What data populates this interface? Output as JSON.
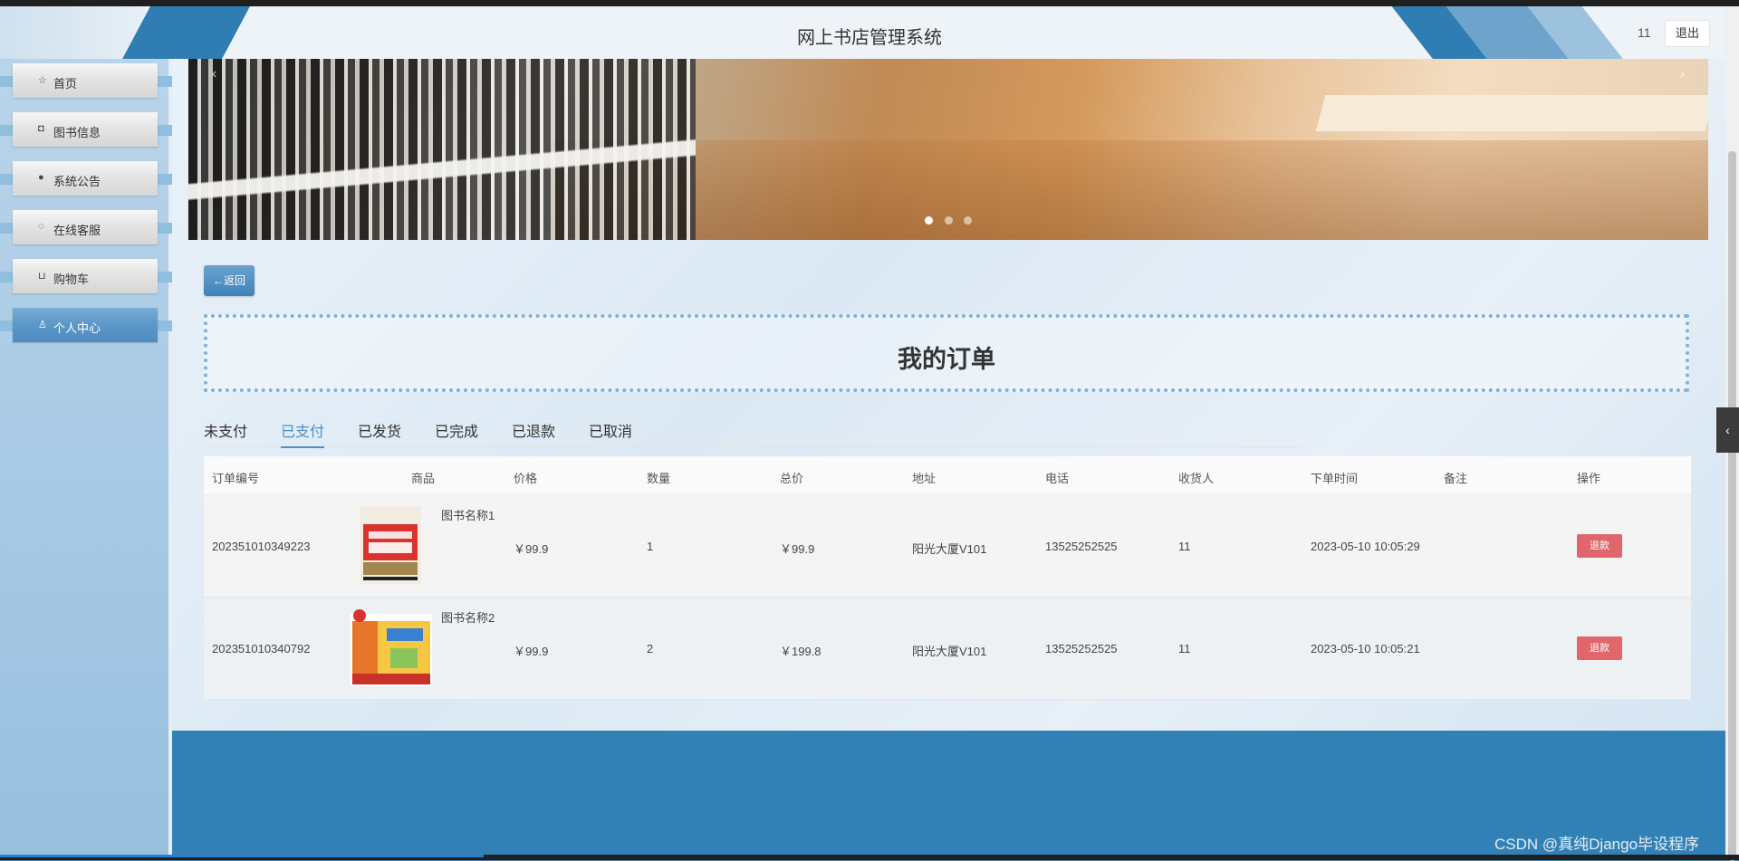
{
  "header": {
    "title": "网上书店管理系统",
    "user": "11",
    "logout_label": "退出"
  },
  "sidebar": {
    "items": [
      {
        "label": "首页",
        "icon": "☆"
      },
      {
        "label": "图书信息",
        "icon": "◘"
      },
      {
        "label": "系统公告",
        "icon": "●"
      },
      {
        "label": "在线客服",
        "icon": "◌"
      },
      {
        "label": "购物车",
        "icon": "⊔"
      },
      {
        "label": "个人中心",
        "icon": "♙"
      }
    ]
  },
  "main": {
    "back_label": "←返回",
    "page_title": "我的订单",
    "tabs": [
      "未支付",
      "已支付",
      "已发货",
      "已完成",
      "已退款",
      "已取消"
    ],
    "active_tab": "已支付",
    "table": {
      "headers": [
        "订单编号",
        "商品",
        "价格",
        "数量",
        "总价",
        "地址",
        "电话",
        "收货人",
        "下单时间",
        "备注",
        "操作"
      ],
      "rows": [
        {
          "order_no": "202351010349223",
          "product": "图书名称1",
          "price": "￥99.9",
          "qty": "1",
          "total": "￥99.9",
          "address": "阳光大厦V101",
          "phone": "13525252525",
          "receiver": "11",
          "time": "2023-05-10 10:05:29",
          "note": "",
          "action": "退款"
        },
        {
          "order_no": "202351010340792",
          "product": "图书名称2",
          "price": "￥99.9",
          "qty": "2",
          "total": "￥199.8",
          "address": "阳光大厦V101",
          "phone": "13525252525",
          "receiver": "11",
          "time": "2023-05-10 10:05:21",
          "note": "",
          "action": "退款"
        }
      ]
    }
  },
  "watermark": "CSDN @真纯Django毕设程序",
  "colors": {
    "accent": "#4a90c8",
    "brand_blue": "#3281b6",
    "refund_red": "#e0666c"
  }
}
